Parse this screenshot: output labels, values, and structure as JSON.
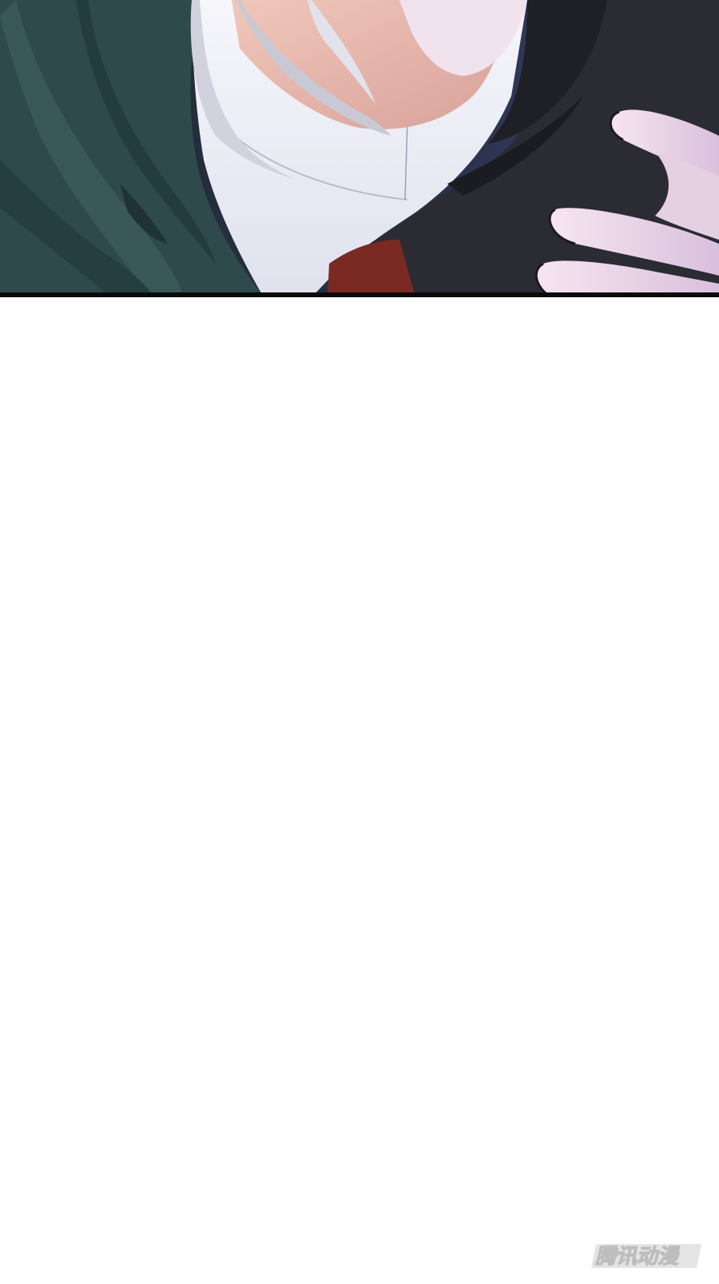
{
  "panel": {
    "scene": "comic-panel-closeup",
    "colors": {
      "hair_dark": "#2f4a4c",
      "hair_mid": "#3b5859",
      "hair_light": "#c9c9d6",
      "skin": "#e7b7ae",
      "shirt": "#eef0f7",
      "coat": "#2b2b33",
      "ribbon": "#7a2a22",
      "background": "#2b3557",
      "hand": "#efd7e8",
      "border": "#0b0b0b"
    }
  },
  "watermark": {
    "text": "腾讯动漫",
    "color": "#c7c7c7"
  }
}
